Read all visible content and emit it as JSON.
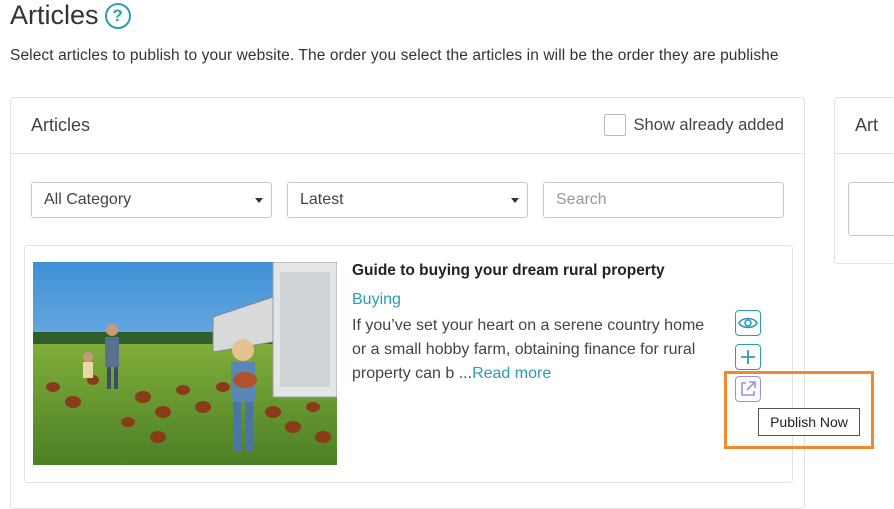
{
  "header": {
    "title": "Articles",
    "subtitle": "Select articles to publish to your website. The order you select the articles in will be the order they are publishe"
  },
  "articles_panel": {
    "title": "Articles",
    "show_added_label": "Show already added",
    "show_added_checked": false,
    "filters": {
      "category": "All Category",
      "sort": "Latest",
      "search_placeholder": "Search"
    },
    "items": [
      {
        "title": "Guide to buying your dream rural property",
        "category": "Buying",
        "excerpt": "If you’ve set your heart on a serene country home or a small hobby farm, obtaining finance for rural property can b ...",
        "read_more": "Read more",
        "actions": [
          "eye-icon",
          "plus-icon",
          "external-link-icon"
        ]
      }
    ]
  },
  "tooltip": {
    "text": "Publish Now"
  },
  "second_panel": {
    "title": "Art"
  },
  "colors": {
    "accent": "#2a9db0",
    "publish_icon": "#a08fe0",
    "highlight": "#f08a2c"
  }
}
